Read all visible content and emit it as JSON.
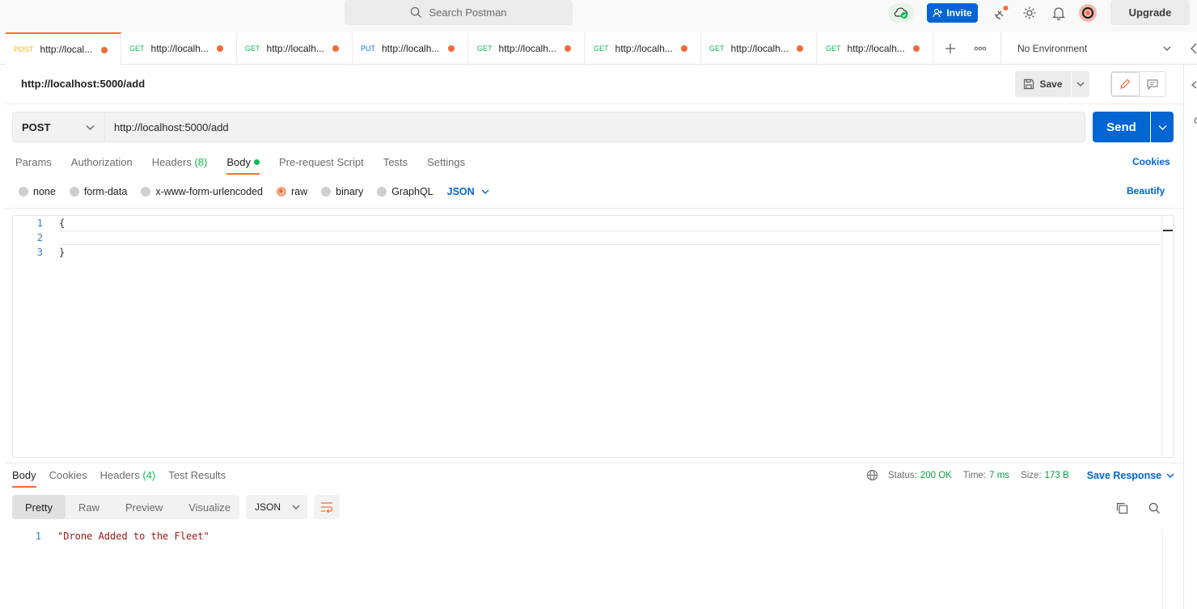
{
  "header": {
    "search_placeholder": "Search Postman",
    "invite_label": "Invite",
    "upgrade_label": "Upgrade"
  },
  "tabs": [
    {
      "method": "POST",
      "url": "http://localhost:5000/add",
      "url_short": "http://local..."
    },
    {
      "method": "GET",
      "url": "http://localh...",
      "url_short": "http://localh..."
    },
    {
      "method": "GET",
      "url": "http://localh...",
      "url_short": "http://localh..."
    },
    {
      "method": "PUT",
      "url": "http://localh...",
      "url_short": "http://localh..."
    },
    {
      "method": "GET",
      "url": "http://localh...",
      "url_short": "http://localh..."
    },
    {
      "method": "GET",
      "url": "http://localh...",
      "url_short": "http://localh..."
    },
    {
      "method": "GET",
      "url": "http://localh...",
      "url_short": "http://localh..."
    },
    {
      "method": "GET",
      "url": "http://localh...",
      "url_short": "http://localh..."
    }
  ],
  "environment": "No Environment",
  "request": {
    "title": "http://localhost:5000/add",
    "save_label": "Save",
    "method": "POST",
    "url": "http://localhost:5000/add",
    "send_label": "Send",
    "subtabs": {
      "params": "Params",
      "authorization": "Authorization",
      "headers": "Headers",
      "headers_count": "(8)",
      "body": "Body",
      "prerequest": "Pre-request Script",
      "tests": "Tests",
      "settings": "Settings"
    },
    "cookies_label": "Cookies",
    "body_types": {
      "none": "none",
      "form_data": "form-data",
      "urlencoded": "x-www-form-urlencoded",
      "raw": "raw",
      "binary": "binary",
      "graphql": "GraphQL",
      "language": "JSON"
    },
    "beautify_label": "Beautify",
    "body_lines": [
      {
        "n": "1",
        "code": "{"
      },
      {
        "n": "2",
        "code": ""
      },
      {
        "n": "3",
        "code": "}"
      }
    ]
  },
  "response": {
    "tabs": {
      "body": "Body",
      "cookies": "Cookies",
      "headers": "Headers",
      "headers_count": "(4)",
      "test_results": "Test Results"
    },
    "status_label": "Status:",
    "status_value": "200 OK",
    "time_label": "Time:",
    "time_value": "7 ms",
    "size_label": "Size:",
    "size_value": "173 B",
    "save_response_label": "Save Response",
    "view_modes": {
      "pretty": "Pretty",
      "raw": "Raw",
      "preview": "Preview",
      "visualize": "Visualize"
    },
    "format": "JSON",
    "lines": [
      {
        "n": "1",
        "code": "\"Drone Added to the Fleet\""
      }
    ]
  }
}
